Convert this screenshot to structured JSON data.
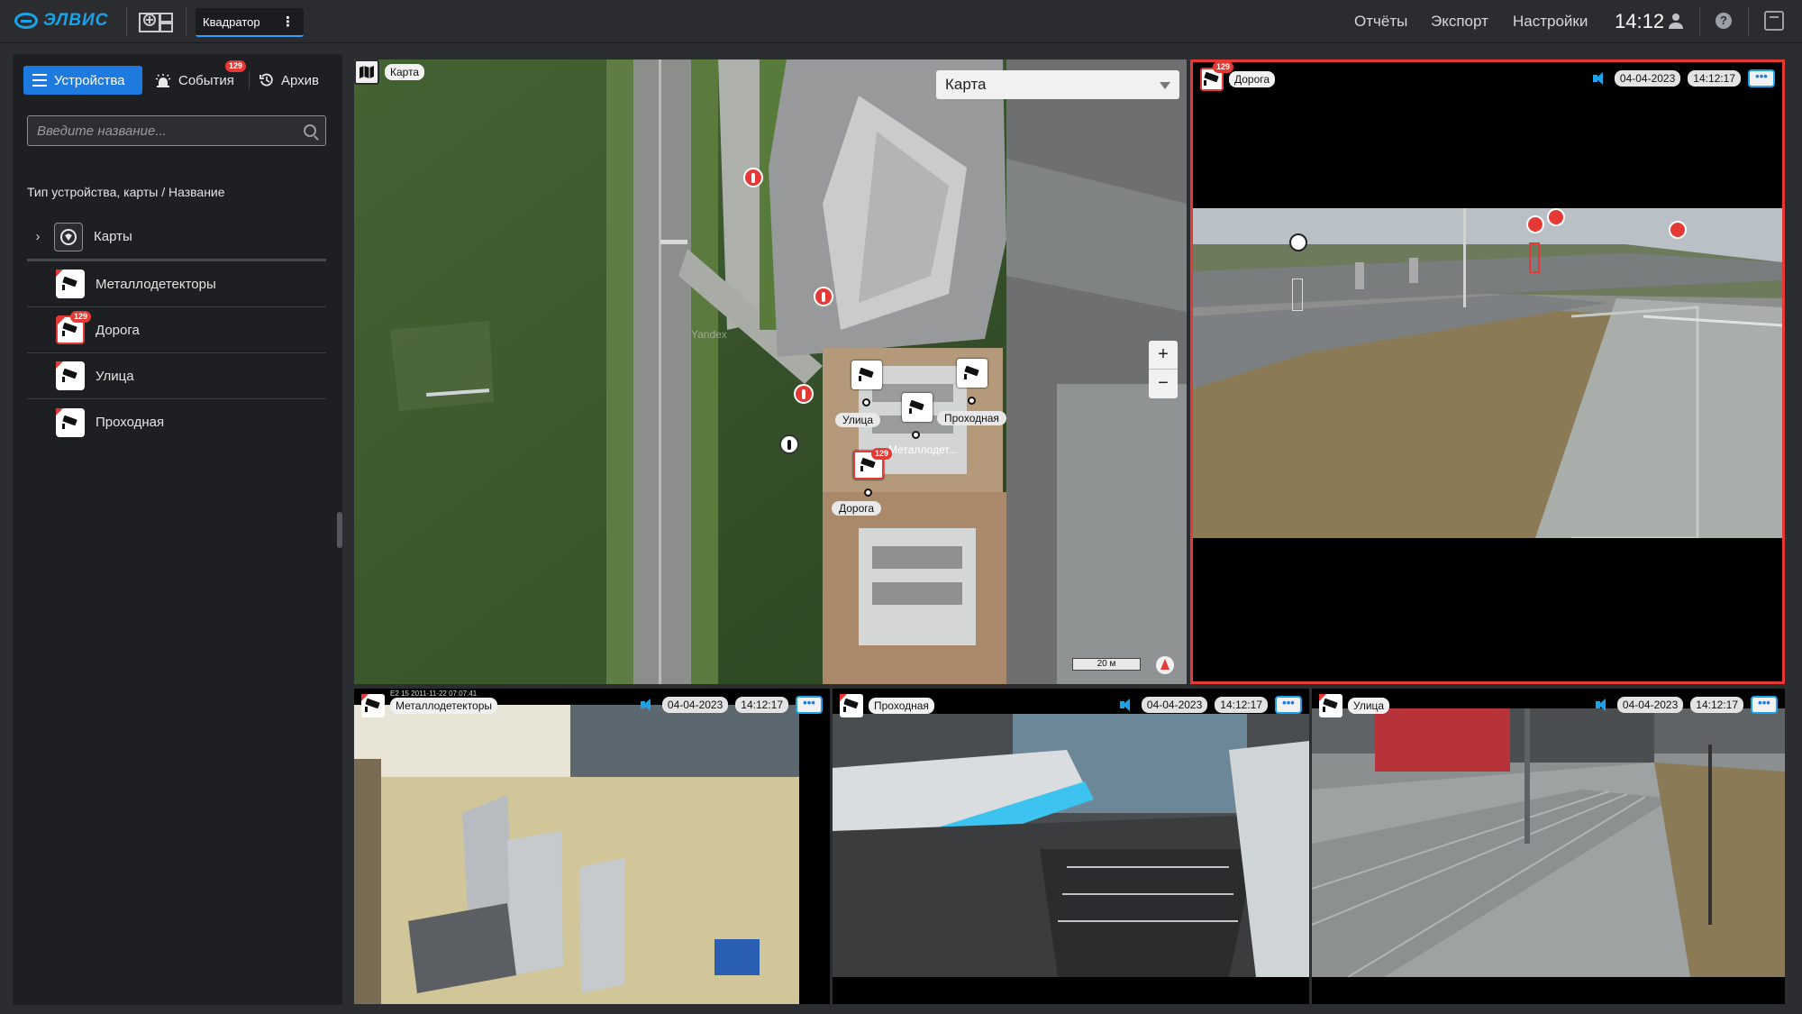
{
  "header": {
    "logo_text": "ЭЛВИС",
    "tab_label": "Квадратор",
    "nav": [
      "Отчёты",
      "Экспорт",
      "Настройки"
    ],
    "clock": "14:12",
    "accent": "#1aa3e8"
  },
  "sidebar": {
    "tabs": [
      {
        "label": "Устройства",
        "icon": "list-icon"
      },
      {
        "label": "События",
        "icon": "events-icon",
        "badge": "129"
      },
      {
        "label": "Архив",
        "icon": "history-icon"
      }
    ],
    "search": {
      "placeholder": "Введите название..."
    },
    "header": "Тип устройства, карты / Название",
    "items": [
      {
        "label": "Карты",
        "icon": "map-group-icon"
      },
      {
        "label": "Металлодетекторы",
        "icon": "camera-icon"
      },
      {
        "label": "Дорога",
        "icon": "camera-icon",
        "badge": "129",
        "alert": true
      },
      {
        "label": "Улица",
        "icon": "camera-icon"
      },
      {
        "label": "Проходная",
        "icon": "camera-icon"
      }
    ]
  },
  "map": {
    "title": "Карта",
    "select_value": "Карта",
    "zoom_in": "+",
    "zoom_out": "−",
    "scale": "20 м",
    "watermark": "Yandex",
    "markers": [
      {
        "label": "Улица"
      },
      {
        "label": "Проходная"
      },
      {
        "label": "Металлодет..."
      },
      {
        "label": "Дорога",
        "badge": "129"
      }
    ]
  },
  "cameras": {
    "doroga": {
      "name": "Дорога",
      "badge": "129",
      "date": "04-04-2023",
      "time": "14:12:17"
    },
    "metal": {
      "name": "Металлодетекторы",
      "date": "04-04-2023",
      "time": "14:12:17",
      "overlay": "E2 15 2011-11-22 07:07:41"
    },
    "prohod": {
      "name": "Проходная",
      "date": "04-04-2023",
      "time": "14:12:17"
    },
    "ulica": {
      "name": "Улица",
      "date": "04-04-2023",
      "time": "14:12:17"
    }
  },
  "more_label": "•••",
  "colors": {
    "alert": "#e53935",
    "accent": "#1f7ae0"
  }
}
